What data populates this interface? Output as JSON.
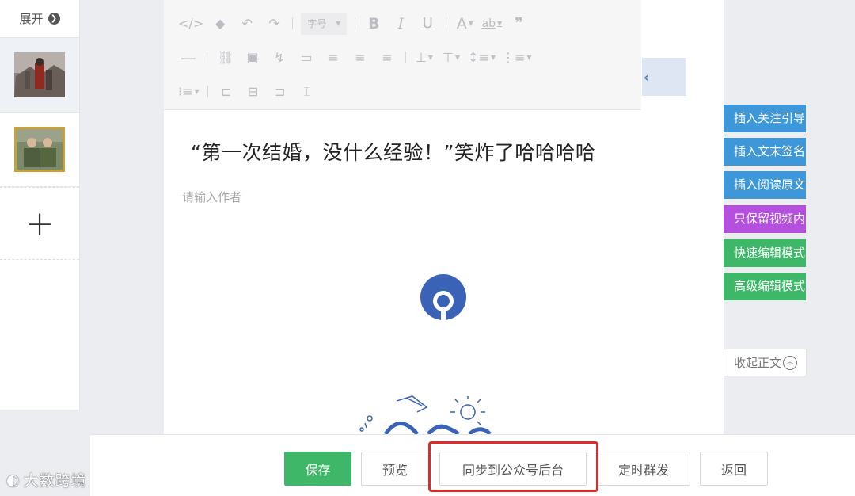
{
  "sidebar": {
    "expand_label": "展开",
    "expand_icon": "chevron-right-circle-icon",
    "add_symbol": "+"
  },
  "toolbar": {
    "font_size_label": "字号"
  },
  "editor": {
    "title": "“第一次结婚，没什么经验！”笑炸了哈哈哈哈",
    "author_placeholder": "请输入作者"
  },
  "side_panel": {
    "buttons": [
      {
        "label": "插入关注引导",
        "color": "#3d97d9"
      },
      {
        "label": "插入文末签名",
        "color": "#3d97d9"
      },
      {
        "label": "插入阅读原文",
        "color": "#3d97d9"
      },
      {
        "label": "只保留视频内容",
        "color": "#b44fe0"
      },
      {
        "label": "快速编辑模式",
        "color": "#3fb768"
      },
      {
        "label": "高级编辑模式",
        "color": "#3fb768"
      }
    ],
    "collapse_body_label": "收起正文"
  },
  "bottom_bar": {
    "save": "保存",
    "preview": "预览",
    "sync": "同步到公众号后台",
    "schedule": "定时群发",
    "back": "返回"
  },
  "watermark": "大数跨境",
  "colors": {
    "primary_green": "#3fb768",
    "info_blue": "#3d97d9",
    "purple": "#b44fe0",
    "highlight_red": "#de2c2c",
    "logo_blue": "#3a63b8"
  }
}
